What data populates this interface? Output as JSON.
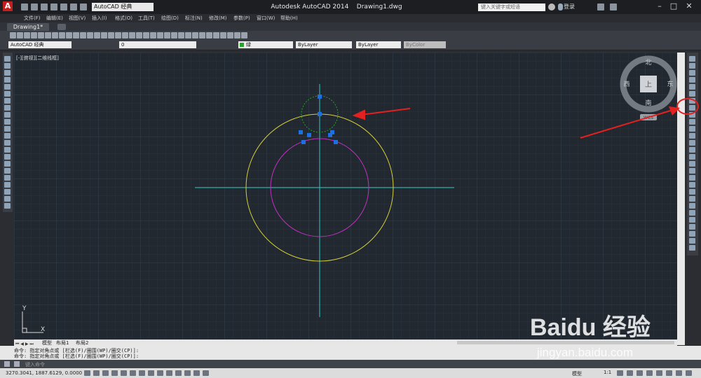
{
  "app": {
    "title": "Autodesk AutoCAD 2014",
    "file": "Drawing1.dwg",
    "logo": "A",
    "workspace": "AutoCAD 经典",
    "search_placeholder": "键入关键字或短语",
    "login": "登录"
  },
  "menu": [
    "文件(F)",
    "编辑(E)",
    "视图(V)",
    "插入(I)",
    "格式(O)",
    "工具(T)",
    "绘图(D)",
    "标注(N)",
    "修改(M)",
    "参数(P)",
    "窗口(W)",
    "帮助(H)"
  ],
  "tabs": {
    "document": "Drawing1*"
  },
  "toolbar": {
    "workspace_combo": "AutoCAD 经典",
    "layer_value": "0",
    "color_value": "绿",
    "linetype_value": "ByLayer",
    "lineweight_value": "ByLayer",
    "plotstyle_value": "ByColor"
  },
  "viewport": {
    "label": "[-][俯视][二维线框]",
    "viewcube": {
      "north": "北",
      "south": "南",
      "east": "东",
      "west": "西",
      "top": "上",
      "wcs": "WCS"
    },
    "ucs": {
      "x": "X",
      "y": "Y"
    }
  },
  "layout_tabs": [
    "模型",
    "布局1",
    "布局2"
  ],
  "command": {
    "lines": [
      "命令: 指定对角点或 [栏选(F)/圈围(WP)/圈交(CP)]:",
      "命令: 指定对角点或 [栏选(F)/圈围(WP)/圈交(CP)]:"
    ],
    "input_placeholder": "键入命令"
  },
  "status": {
    "coords": "3270.3041, 1887.6129, 0.0000",
    "model": "模型",
    "scale": "1:1"
  },
  "watermark": {
    "brand": "Baidu 经验",
    "url": "jingyan.baidu.com"
  },
  "colors": {
    "yellow_circle": "#d4cf3a",
    "magenta_circle": "#c231c2",
    "green_circle": "#26a626",
    "centerline": "#35c6c6",
    "grip": "#1e6fe0",
    "arrow": "#e52020"
  }
}
